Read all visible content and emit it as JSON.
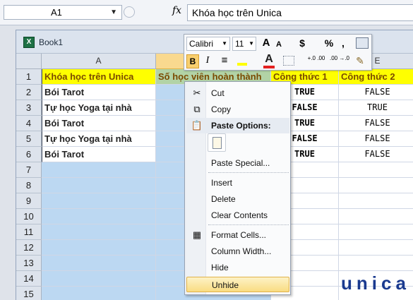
{
  "formula_bar": {
    "name_box": "A1",
    "fx_label": "fx",
    "formula": "Khóa học trên Unica"
  },
  "workbook": {
    "title": "Book1"
  },
  "columns": [
    "A",
    "",
    "",
    "E"
  ],
  "rows": [
    {
      "n": "1",
      "a": "Khóa học trên Unica",
      "b": "Số học viên hoàn thành",
      "d": "Công thức 1",
      "e": "Công thức 2"
    },
    {
      "n": "2",
      "a": "Bói Tarot",
      "b": "",
      "d": "TRUE",
      "e": "FALSE"
    },
    {
      "n": "3",
      "a": "Tự học Yoga tại nhà",
      "b": "",
      "d": "FALSE",
      "e": "TRUE"
    },
    {
      "n": "4",
      "a": "Bói Tarot",
      "b": "",
      "d": "TRUE",
      "e": "FALSE"
    },
    {
      "n": "5",
      "a": "Tự học Yoga tại nhà",
      "b": "",
      "d": "FALSE",
      "e": "FALSE"
    },
    {
      "n": "6",
      "a": "Bói Tarot",
      "b": "",
      "d": "TRUE",
      "e": "FALSE"
    },
    {
      "n": "7"
    },
    {
      "n": "8"
    },
    {
      "n": "9"
    },
    {
      "n": "10"
    },
    {
      "n": "11"
    },
    {
      "n": "12"
    },
    {
      "n": "13"
    },
    {
      "n": "14"
    },
    {
      "n": "15"
    }
  ],
  "mini_toolbar": {
    "font": "Calibri",
    "size": "11",
    "grow": "A",
    "shrink": "A",
    "currency": "$",
    "percent": "%",
    "comma": ",",
    "bold": "B",
    "italic": "I",
    "align": "≡",
    "font_color": "A",
    "inc_dec": "+.0 .00",
    "dec_dec": ".00 →.0"
  },
  "context_menu": {
    "cut": "Cut",
    "copy": "Copy",
    "paste_options": "Paste Options:",
    "paste_special": "Paste Special...",
    "insert": "Insert",
    "delete": "Delete",
    "clear_contents": "Clear Contents",
    "format_cells": "Format Cells...",
    "column_width": "Column Width...",
    "hide": "Hide",
    "unhide": "Unhide"
  },
  "logo": {
    "text": "unica"
  },
  "colors": {
    "header_fill": "#ffff00",
    "selection": "#bcd8f2",
    "menu_highlight": "#f9dc82"
  }
}
